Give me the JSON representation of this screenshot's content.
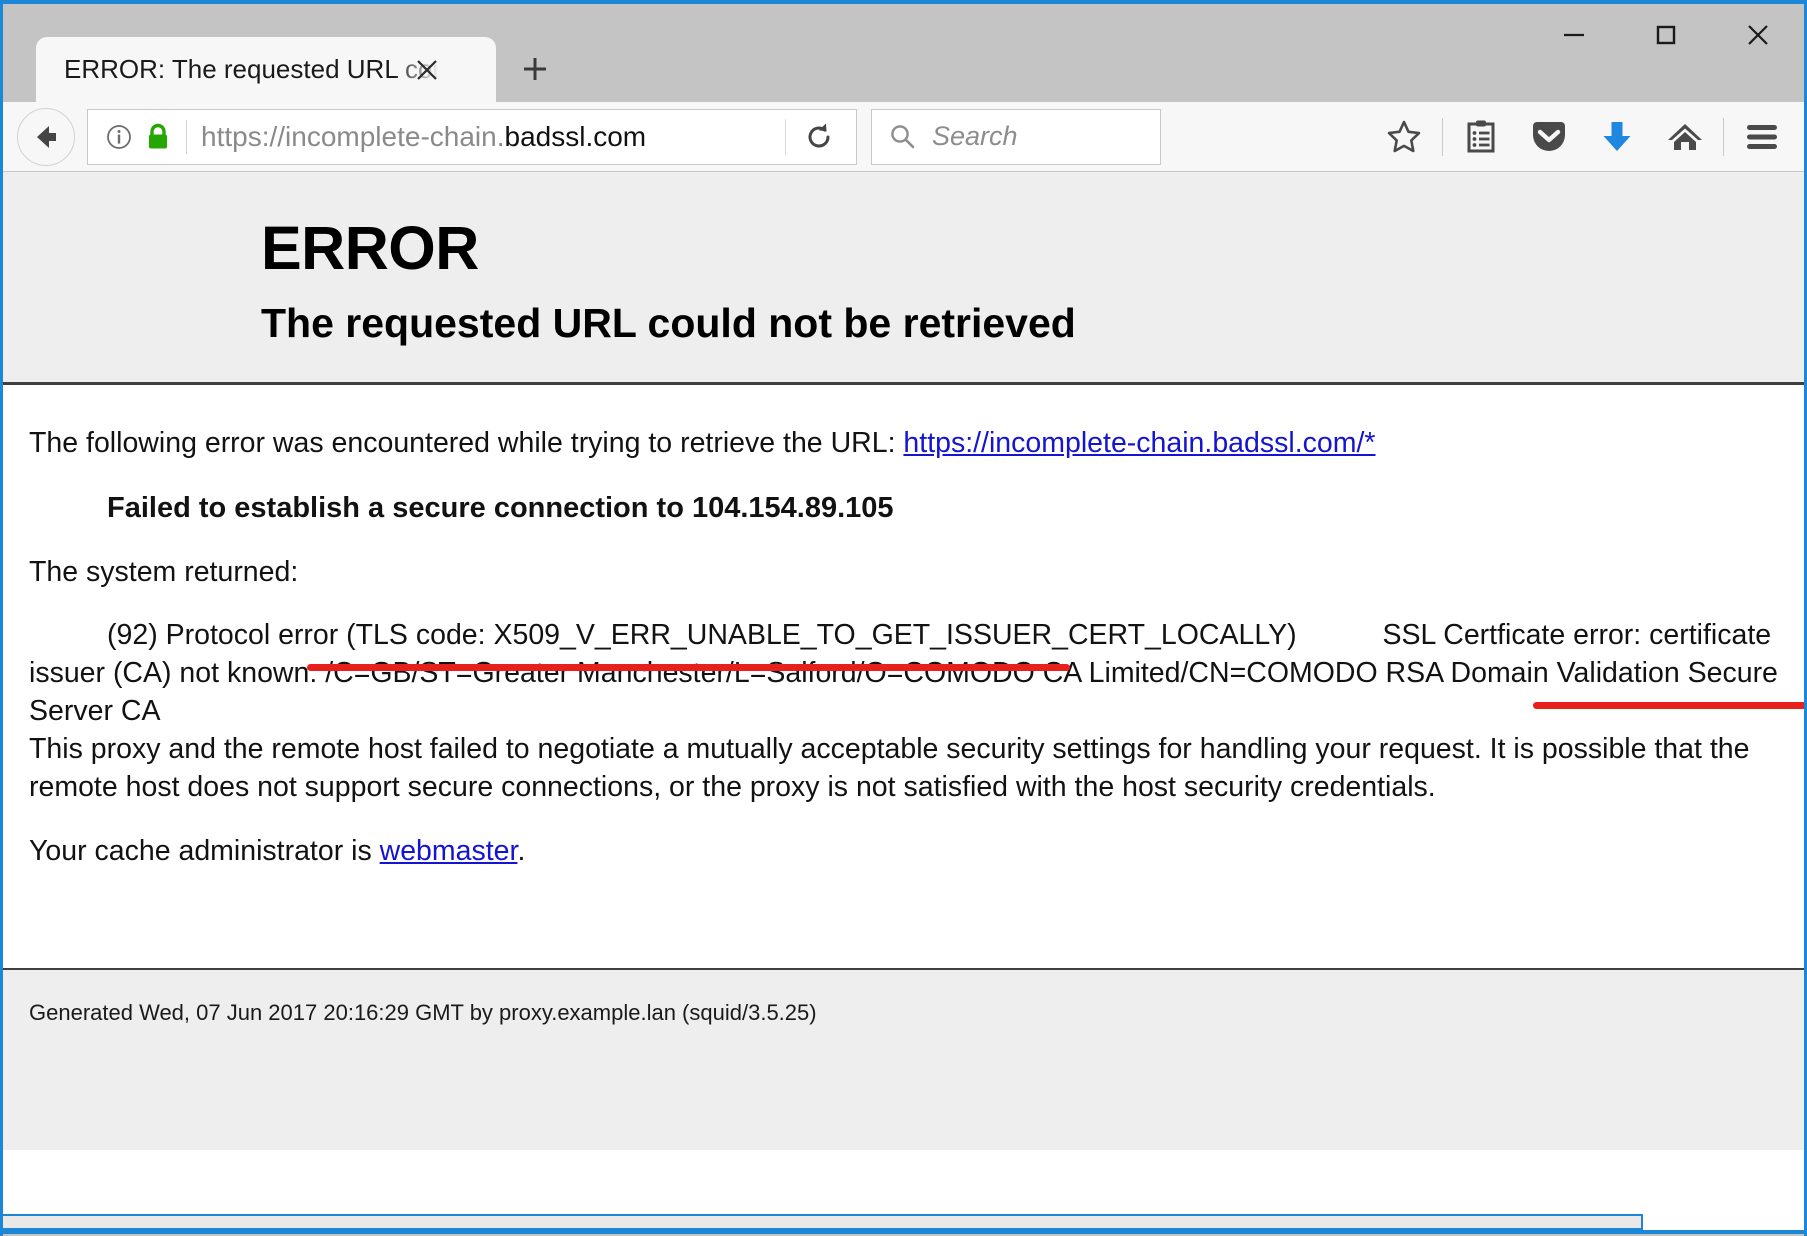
{
  "window": {
    "controls": {
      "minimize_label": "Minimize",
      "maximize_label": "Maximize",
      "close_label": "Close"
    }
  },
  "tabs": [
    {
      "title": "ERROR: The requested URL could not be retrieved",
      "close_label": "Close tab",
      "active": true
    }
  ],
  "new_tab_label": "+",
  "navbar": {
    "back_label": "Back",
    "identity_label": "Site information",
    "lock_label": "Secure connection",
    "url_prefix": "https://incomplete-chain.",
    "url_domain": "badssl.com",
    "reload_label": "Reload",
    "search_placeholder": "Search",
    "icons": [
      "star-icon",
      "reader-list-icon",
      "pocket-icon",
      "downloads-icon",
      "home-icon",
      "hamburger-menu-icon"
    ]
  },
  "page": {
    "title": "ERROR",
    "subtitle": "The requested URL could not be retrieved",
    "intro_prefix": "The following error was encountered while trying to retrieve the URL: ",
    "intro_link": "https://incomplete-chain.badssl.com/*",
    "failed_line": "Failed to establish a secure connection to 104.154.89.105",
    "system_returned": "The system returned:",
    "protocol_error": "(92) Protocol error (TLS code: X509_V_ERR_UNABLE_TO_GET_ISSUER_CERT_LOCALLY)",
    "ssl_error": "SSL Certficate error: certificate issuer (CA) not known: /C=GB/ST=Greater Manchester/L=Salford/O=COMODO CA Limited/CN=COMODO RSA Domain Validation Secure Server CA",
    "proxy_paragraph": "This proxy and the remote host failed to negotiate a mutually acceptable security settings for handling your request. It is possible that the remote host does not support secure connections, or the proxy is not satisfied with the host security credentials.",
    "admin_prefix": "Your cache administrator is ",
    "admin_link": "webmaster",
    "admin_suffix": ".",
    "generated": "Generated Wed, 07 Jun 2017 20:16:29 GMT by proxy.example.lan (squid/3.5.25)"
  },
  "colors": {
    "highlight_red": "#e8201c",
    "link_blue": "#1414d2",
    "accent_blue": "#1b87d6",
    "download_blue": "#1f87e0",
    "lock_green": "#26a603"
  }
}
